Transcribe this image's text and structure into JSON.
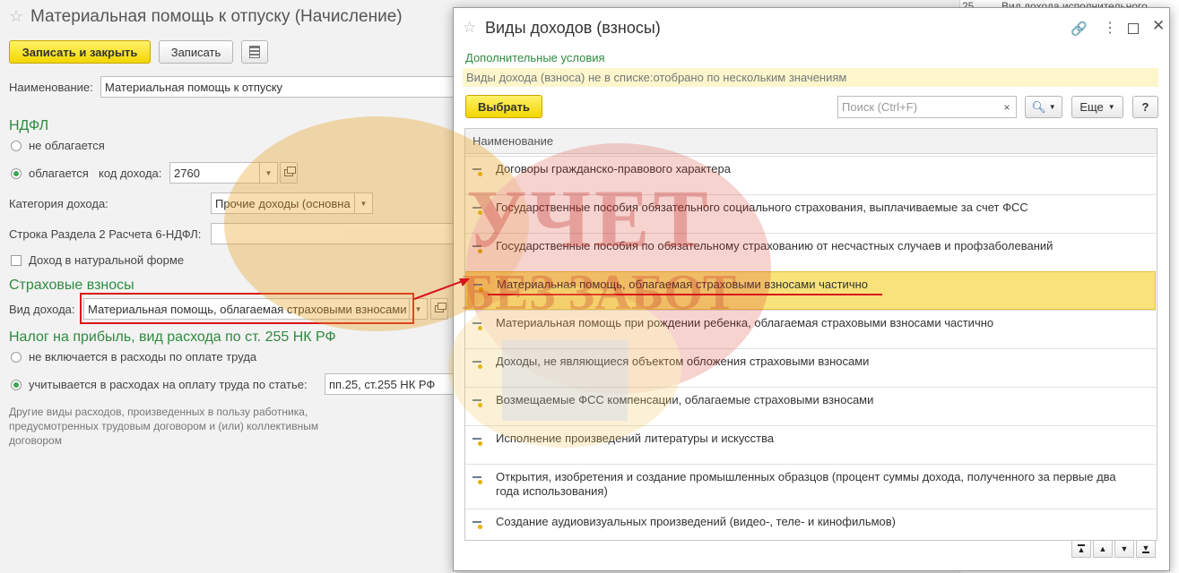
{
  "form": {
    "title": "Материальная помощь к отпуску (Начисление)",
    "btn_save_close": "Записать и закрыть",
    "btn_save": "Записать",
    "name_label": "Наименование:",
    "name_value": "Материальная помощь к отпуску",
    "ndfl_heading": "НДФЛ",
    "radio_not_taxed": "не облагается",
    "radio_taxed": "облагается",
    "income_code_label": "код дохода:",
    "income_code_value": "2760",
    "income_category_label": "Категория дохода:",
    "income_category_value": "Прочие доходы (основна",
    "row_6ndfl_label": "Строка Раздела 2 Расчета 6-НДФЛ:",
    "row_6ndfl_value": "",
    "natural_form_label": "Доход в натуральной форме",
    "contrib_heading": "Страховые взносы",
    "income_type_label": "Вид дохода:",
    "income_type_value": "Материальная помощь, облагаемая страховыми взносами",
    "profit_heading": "Налог на прибыль, вид расхода по ст. 255 НК РФ",
    "radio_not_included": "не включается в расходы по оплате труда",
    "radio_included": "учитывается в расходах на оплату труда по статье:",
    "article_value": "пп.25, ст.255 НК РФ",
    "note": "Другие виды расходов, произведенных в пользу работника, предусмотренных трудовым договором и (или) коллективным договором"
  },
  "background_right": {
    "row1_text": "Вид дохода исполнительного",
    "row1_num": "25"
  },
  "dialog": {
    "title": "Виды доходов (взносы)",
    "extra_conditions": "Дополнительные условия",
    "filter_text": "Виды дохода (взноса) не в списке:отобрано по нескольким значениям",
    "select_button": "Выбрать",
    "search_placeholder": "Поиск (Ctrl+F)",
    "more_button": "Еще",
    "help_button": "?",
    "column_header": "Наименование",
    "items": [
      "Договоры гражданско-правового характера",
      "Государственные пособия обязательного социального страхования, выплачиваемые за счет ФСС",
      "Государственные пособия по обязательному страхованию от несчастных случаев и профзаболеваний",
      "Материальная помощь, облагаемая страховыми взносами частично",
      "Материальная помощь при рождении ребенка, облагаемая страховыми взносами частично",
      "Доходы, не являющиеся объектом обложения страховыми взносами",
      "Возмещаемые ФСС компенсации, облагаемые страховыми взносами",
      "Исполнение произведений литературы и искусства",
      "Открытия, изобретения и создание промышленных образцов (процент суммы дохода, полученного за первые два года использования)",
      "Создание аудиовизуальных произведений (видео-, теле- и кинофильмов)"
    ],
    "selected_index": 3
  },
  "watermark": {
    "line1": "УЧЕТ",
    "line2": "БЕЗ ЗАБОТ"
  },
  "colors": {
    "accent_green": "#2e8b3f",
    "highlight_yellow": "#f8e27a",
    "annotation_red": "#d9141b"
  }
}
